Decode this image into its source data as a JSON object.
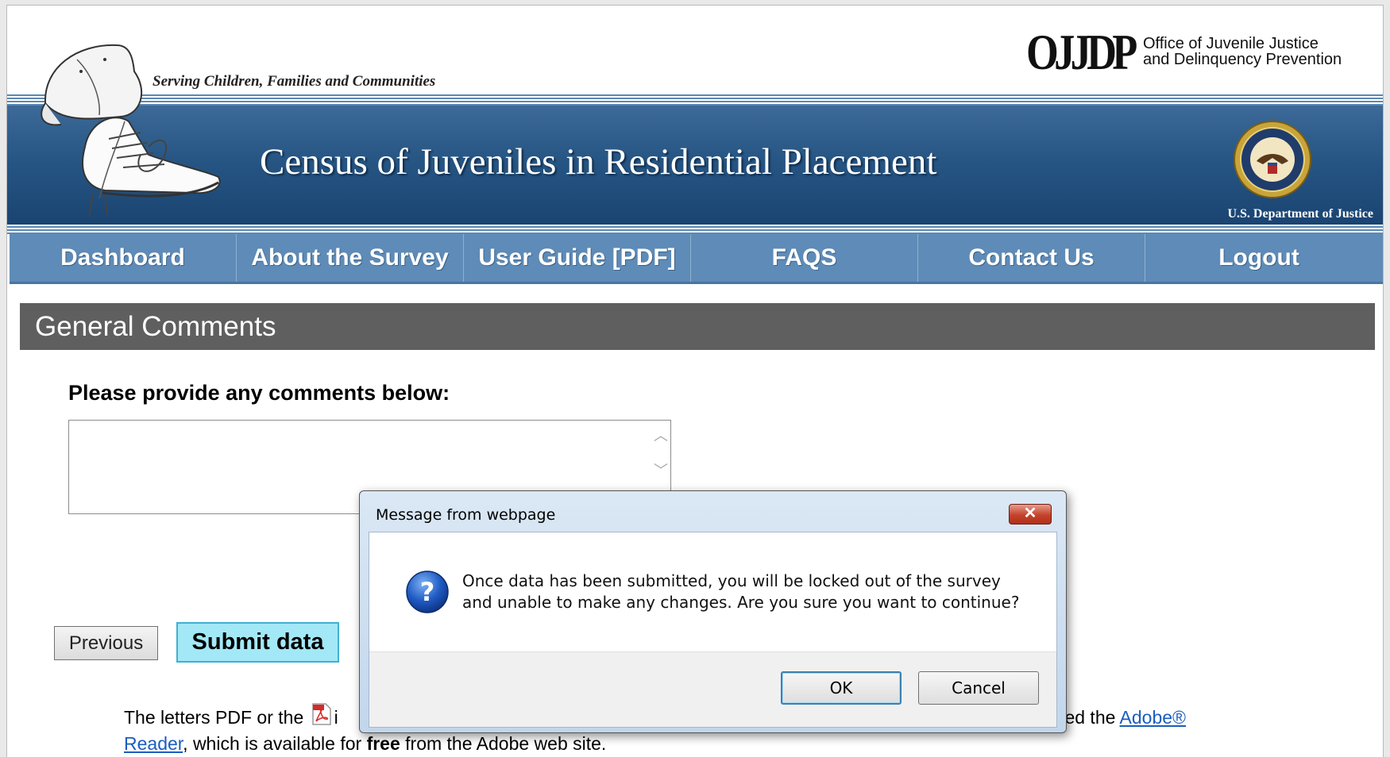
{
  "header": {
    "tagline": "Serving Children, Families and Communities",
    "site_title": "Census of Juveniles in Residential Placement",
    "ojjdp_logo": "OJJDP",
    "ojjdp_name_line1": "Office of Juvenile Justice",
    "ojjdp_name_line2": "and Delinquency Prevention",
    "doj_label": "U.S. Department of Justice"
  },
  "nav": {
    "items": [
      {
        "label": "Dashboard"
      },
      {
        "label": "About the Survey"
      },
      {
        "label": "User Guide [PDF]"
      },
      {
        "label": "FAQS"
      },
      {
        "label": "Contact Us"
      },
      {
        "label": "Logout"
      }
    ]
  },
  "main": {
    "section_title": "General Comments",
    "prompt": "Please provide any comments below:",
    "comments_value": "",
    "previous_label": "Previous",
    "submit_label": "Submit data",
    "footnote": {
      "part1": "The letters PDF or the",
      "part2": "i",
      "part3": "will need the",
      "link1": "Adobe®",
      "link2": "Reader",
      "part4": ", which is available for",
      "bold": "free",
      "part5": "from the Adobe web site."
    }
  },
  "dialog": {
    "title": "Message from webpage",
    "close_glyph": "✕",
    "message": "Once data has been submitted, you will be locked out of the survey and unable to make any changes. Are you sure you want to continue?",
    "ok_label": "OK",
    "cancel_label": "Cancel"
  },
  "colors": {
    "nav_bg": "#5e8bb7",
    "section_header_bg": "#5f5f5f",
    "submit_bg": "#a3e8f7",
    "banner_blue": "#275684"
  },
  "icons": [
    "shoes-logo-icon",
    "doj-seal-icon",
    "pdf-icon",
    "question-icon",
    "close-icon"
  ]
}
